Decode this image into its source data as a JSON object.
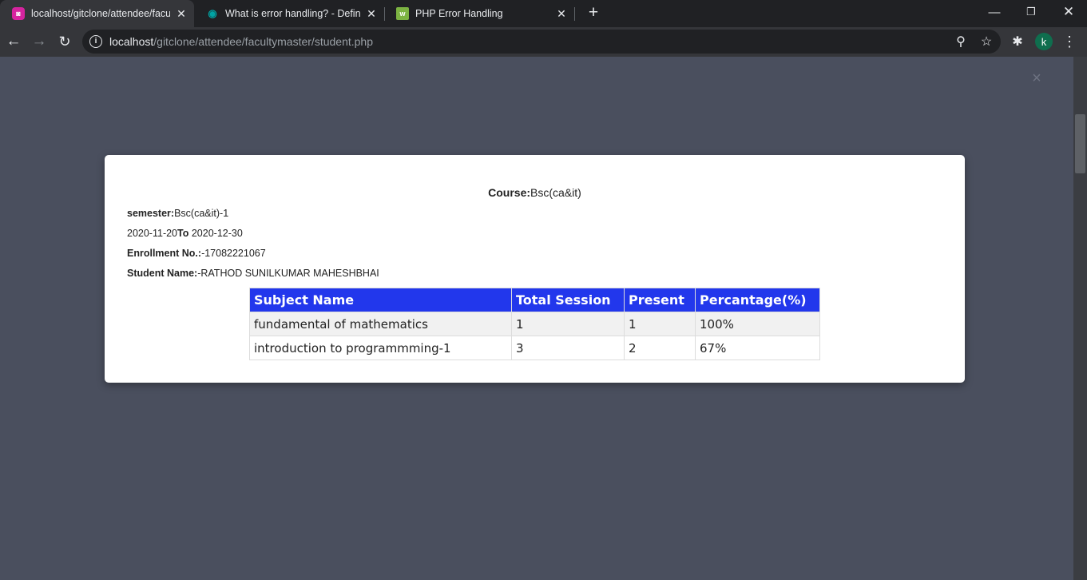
{
  "browser": {
    "tabs": [
      {
        "title": "localhost/gitclone/attendee/facu",
        "active": true,
        "favicon": "attendee-app-icon",
        "favicon_color": "#d6249f"
      },
      {
        "title": "What is error handling? - Definiti",
        "active": false,
        "favicon": "eye-icon",
        "favicon_color": "#00a3a3"
      },
      {
        "title": "PHP Error Handling",
        "active": false,
        "favicon": "w3schools-icon",
        "favicon_color": "#7cb342"
      }
    ],
    "url_host": "localhost",
    "url_path": "/gitclone/attendee/facultymaster/student.php",
    "profile_initial": "k"
  },
  "report": {
    "course_label": "Course:",
    "course_value": "Bsc(ca&it)",
    "semester_label": "semester:",
    "semester_value": "Bsc(ca&it)-1",
    "date_from": "2020-11-20",
    "date_to_label": "To",
    "date_to": "2020-12-30",
    "enrollment_label": "Enrollment No.:",
    "enrollment_value": "-17082221067",
    "student_label": "Student Name:",
    "student_value": "-RATHOD SUNILKUMAR MAHESHBHAI",
    "table": {
      "headers": [
        "Subject Name",
        "Total Session",
        "Present",
        "Percantage(%)"
      ],
      "rows": [
        [
          "fundamental of mathematics",
          "1",
          "1",
          "100%"
        ],
        [
          "introduction to programmming-1",
          "3",
          "2",
          "67%"
        ]
      ]
    }
  },
  "colors": {
    "page_backdrop": "#4a4f5e",
    "table_header": "#2237ec"
  }
}
